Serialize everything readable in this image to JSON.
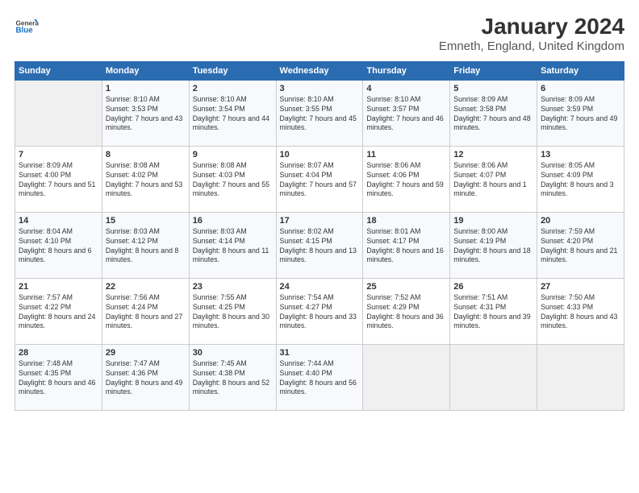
{
  "header": {
    "logo_general": "General",
    "logo_blue": "Blue",
    "title": "January 2024",
    "subtitle": "Emneth, England, United Kingdom"
  },
  "days_of_week": [
    "Sunday",
    "Monday",
    "Tuesday",
    "Wednesday",
    "Thursday",
    "Friday",
    "Saturday"
  ],
  "weeks": [
    [
      {
        "day": "",
        "empty": true
      },
      {
        "day": "1",
        "sunrise": "Sunrise: 8:10 AM",
        "sunset": "Sunset: 3:53 PM",
        "daylight": "Daylight: 7 hours and 43 minutes."
      },
      {
        "day": "2",
        "sunrise": "Sunrise: 8:10 AM",
        "sunset": "Sunset: 3:54 PM",
        "daylight": "Daylight: 7 hours and 44 minutes."
      },
      {
        "day": "3",
        "sunrise": "Sunrise: 8:10 AM",
        "sunset": "Sunset: 3:55 PM",
        "daylight": "Daylight: 7 hours and 45 minutes."
      },
      {
        "day": "4",
        "sunrise": "Sunrise: 8:10 AM",
        "sunset": "Sunset: 3:57 PM",
        "daylight": "Daylight: 7 hours and 46 minutes."
      },
      {
        "day": "5",
        "sunrise": "Sunrise: 8:09 AM",
        "sunset": "Sunset: 3:58 PM",
        "daylight": "Daylight: 7 hours and 48 minutes."
      },
      {
        "day": "6",
        "sunrise": "Sunrise: 8:09 AM",
        "sunset": "Sunset: 3:59 PM",
        "daylight": "Daylight: 7 hours and 49 minutes."
      }
    ],
    [
      {
        "day": "7",
        "sunrise": "Sunrise: 8:09 AM",
        "sunset": "Sunset: 4:00 PM",
        "daylight": "Daylight: 7 hours and 51 minutes."
      },
      {
        "day": "8",
        "sunrise": "Sunrise: 8:08 AM",
        "sunset": "Sunset: 4:02 PM",
        "daylight": "Daylight: 7 hours and 53 minutes."
      },
      {
        "day": "9",
        "sunrise": "Sunrise: 8:08 AM",
        "sunset": "Sunset: 4:03 PM",
        "daylight": "Daylight: 7 hours and 55 minutes."
      },
      {
        "day": "10",
        "sunrise": "Sunrise: 8:07 AM",
        "sunset": "Sunset: 4:04 PM",
        "daylight": "Daylight: 7 hours and 57 minutes."
      },
      {
        "day": "11",
        "sunrise": "Sunrise: 8:06 AM",
        "sunset": "Sunset: 4:06 PM",
        "daylight": "Daylight: 7 hours and 59 minutes."
      },
      {
        "day": "12",
        "sunrise": "Sunrise: 8:06 AM",
        "sunset": "Sunset: 4:07 PM",
        "daylight": "Daylight: 8 hours and 1 minute."
      },
      {
        "day": "13",
        "sunrise": "Sunrise: 8:05 AM",
        "sunset": "Sunset: 4:09 PM",
        "daylight": "Daylight: 8 hours and 3 minutes."
      }
    ],
    [
      {
        "day": "14",
        "sunrise": "Sunrise: 8:04 AM",
        "sunset": "Sunset: 4:10 PM",
        "daylight": "Daylight: 8 hours and 6 minutes."
      },
      {
        "day": "15",
        "sunrise": "Sunrise: 8:03 AM",
        "sunset": "Sunset: 4:12 PM",
        "daylight": "Daylight: 8 hours and 8 minutes."
      },
      {
        "day": "16",
        "sunrise": "Sunrise: 8:03 AM",
        "sunset": "Sunset: 4:14 PM",
        "daylight": "Daylight: 8 hours and 11 minutes."
      },
      {
        "day": "17",
        "sunrise": "Sunrise: 8:02 AM",
        "sunset": "Sunset: 4:15 PM",
        "daylight": "Daylight: 8 hours and 13 minutes."
      },
      {
        "day": "18",
        "sunrise": "Sunrise: 8:01 AM",
        "sunset": "Sunset: 4:17 PM",
        "daylight": "Daylight: 8 hours and 16 minutes."
      },
      {
        "day": "19",
        "sunrise": "Sunrise: 8:00 AM",
        "sunset": "Sunset: 4:19 PM",
        "daylight": "Daylight: 8 hours and 18 minutes."
      },
      {
        "day": "20",
        "sunrise": "Sunrise: 7:59 AM",
        "sunset": "Sunset: 4:20 PM",
        "daylight": "Daylight: 8 hours and 21 minutes."
      }
    ],
    [
      {
        "day": "21",
        "sunrise": "Sunrise: 7:57 AM",
        "sunset": "Sunset: 4:22 PM",
        "daylight": "Daylight: 8 hours and 24 minutes."
      },
      {
        "day": "22",
        "sunrise": "Sunrise: 7:56 AM",
        "sunset": "Sunset: 4:24 PM",
        "daylight": "Daylight: 8 hours and 27 minutes."
      },
      {
        "day": "23",
        "sunrise": "Sunrise: 7:55 AM",
        "sunset": "Sunset: 4:25 PM",
        "daylight": "Daylight: 8 hours and 30 minutes."
      },
      {
        "day": "24",
        "sunrise": "Sunrise: 7:54 AM",
        "sunset": "Sunset: 4:27 PM",
        "daylight": "Daylight: 8 hours and 33 minutes."
      },
      {
        "day": "25",
        "sunrise": "Sunrise: 7:52 AM",
        "sunset": "Sunset: 4:29 PM",
        "daylight": "Daylight: 8 hours and 36 minutes."
      },
      {
        "day": "26",
        "sunrise": "Sunrise: 7:51 AM",
        "sunset": "Sunset: 4:31 PM",
        "daylight": "Daylight: 8 hours and 39 minutes."
      },
      {
        "day": "27",
        "sunrise": "Sunrise: 7:50 AM",
        "sunset": "Sunset: 4:33 PM",
        "daylight": "Daylight: 8 hours and 43 minutes."
      }
    ],
    [
      {
        "day": "28",
        "sunrise": "Sunrise: 7:48 AM",
        "sunset": "Sunset: 4:35 PM",
        "daylight": "Daylight: 8 hours and 46 minutes."
      },
      {
        "day": "29",
        "sunrise": "Sunrise: 7:47 AM",
        "sunset": "Sunset: 4:36 PM",
        "daylight": "Daylight: 8 hours and 49 minutes."
      },
      {
        "day": "30",
        "sunrise": "Sunrise: 7:45 AM",
        "sunset": "Sunset: 4:38 PM",
        "daylight": "Daylight: 8 hours and 52 minutes."
      },
      {
        "day": "31",
        "sunrise": "Sunrise: 7:44 AM",
        "sunset": "Sunset: 4:40 PM",
        "daylight": "Daylight: 8 hours and 56 minutes."
      },
      {
        "day": "",
        "empty": true
      },
      {
        "day": "",
        "empty": true
      },
      {
        "day": "",
        "empty": true
      }
    ]
  ]
}
